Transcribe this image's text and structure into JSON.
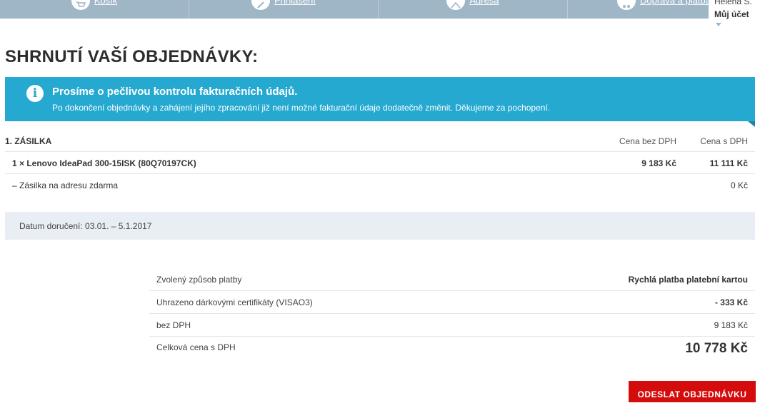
{
  "steps": [
    {
      "label": "Košík",
      "icon": "cart-icon"
    },
    {
      "label": "Přihlášení",
      "icon": "login-icon"
    },
    {
      "label": "Adresa",
      "icon": "address-icon"
    },
    {
      "label": "Doprava a platba",
      "icon": "delivery-icon"
    }
  ],
  "account": {
    "user": "Helena S.",
    "my_account": "Můj účet"
  },
  "page_title": "SHRNUTÍ VAŠÍ OBJEDNÁVKY:",
  "notice": {
    "title": "Prosíme o pečlivou kontrolu fakturačních údajů.",
    "text": "Po dokončení objednávky a zahájení jejího zpracování již není možné fakturační údaje dodatečně změnit. Děkujeme za pochopení.",
    "icon": "i"
  },
  "shipment": {
    "title": "1. ZÁSILKA",
    "col_price_no_vat": "Cena bez DPH",
    "col_price_vat": "Cena s DPH",
    "item": {
      "name": "1 × Lenovo IdeaPad 300-15ISK (80Q70197CK)",
      "price_no_vat": "9 183 Kč",
      "price_vat": "11 111 Kč"
    },
    "shipping": {
      "name": "– Zásilka na adresu zdarma",
      "price": "0 Kč"
    },
    "delivery_date": "Datum doručení: 03.01. – 5.1.2017"
  },
  "summary": {
    "payment_label": "Zvolený způsob platby",
    "payment_value": "Rychlá platba platební kartou",
    "voucher_label": "Uhrazeno dárkovými certifikáty (VISAO3)",
    "voucher_value": "- 333 Kč",
    "no_vat_label": "bez DPH",
    "no_vat_value": "9 183 Kč",
    "total_label": "Celková cena s DPH",
    "total_value": "10 778 Kč"
  },
  "order_button": "ODESLAT OBJEDNÁVKU",
  "colors": {
    "step_bar": "#9fb6c7",
    "notice": "#25a9d0",
    "button": "#d40c0c"
  }
}
